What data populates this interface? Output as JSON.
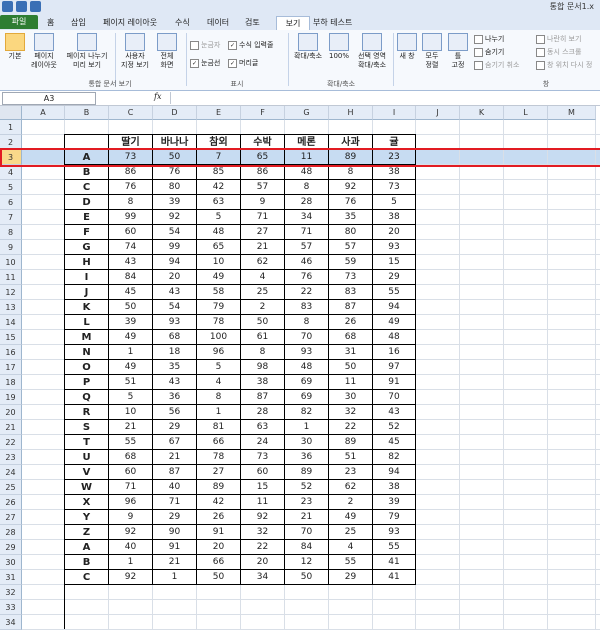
{
  "window": {
    "title": "통합 문서1.x"
  },
  "tabs": [
    "파일",
    "홈",
    "삽입",
    "페이지 레이아웃",
    "수식",
    "데이터",
    "검토",
    "보기",
    "부하 테스트"
  ],
  "active_tab": "보기",
  "ribbon": {
    "normal": "기본",
    "page_layout": "페이지\n레이아웃",
    "page_break": "페이지 나누기\n미리 보기",
    "custom_views": "사용자\n지정 보기",
    "full_screen": "전체\n화면",
    "ruler": "눈금자",
    "formula_bar": "수식 입력줄",
    "gridlines": "눈금선",
    "headings": "머리글",
    "zoom": "확대/축소",
    "zoom100": "100%",
    "zoom_selection": "선택 영역\n확대/축소",
    "new_window": "새 창",
    "arrange_all": "모두\n정렬",
    "freeze_panes": "틀\n고정",
    "split": "나누기",
    "hide": "숨기기",
    "unhide": "숨기기 취소",
    "side_by_side": "나란히 보기",
    "sync_scroll": "동시 스크롤",
    "reset_position": "창 위치 다시 정",
    "group_workbook_views": "통합 문서 보기",
    "group_show": "표시",
    "group_zoom": "확대/축소",
    "group_window": "창"
  },
  "formula_bar": {
    "name_box": "A3",
    "fx": "fx",
    "value": ""
  },
  "columns": [
    "A",
    "B",
    "C",
    "D",
    "E",
    "F",
    "G",
    "H",
    "I",
    "J",
    "K",
    "L",
    "M"
  ],
  "table": {
    "headers": [
      "딸기",
      "바나나",
      "참외",
      "수박",
      "메론",
      "사과",
      "귤"
    ],
    "rows": [
      [
        "A",
        73,
        50,
        7,
        65,
        11,
        89,
        23
      ],
      [
        "B",
        86,
        76,
        85,
        86,
        48,
        8,
        38
      ],
      [
        "C",
        76,
        80,
        42,
        57,
        8,
        92,
        73
      ],
      [
        "D",
        8,
        39,
        63,
        9,
        28,
        76,
        5
      ],
      [
        "E",
        99,
        92,
        5,
        71,
        34,
        35,
        38
      ],
      [
        "F",
        60,
        54,
        48,
        27,
        71,
        80,
        20
      ],
      [
        "G",
        74,
        99,
        65,
        21,
        57,
        57,
        93
      ],
      [
        "H",
        43,
        94,
        10,
        62,
        46,
        59,
        15
      ],
      [
        "I",
        84,
        20,
        49,
        4,
        76,
        73,
        29
      ],
      [
        "J",
        45,
        43,
        58,
        25,
        22,
        83,
        55
      ],
      [
        "K",
        50,
        54,
        79,
        2,
        83,
        87,
        94
      ],
      [
        "L",
        39,
        93,
        78,
        50,
        8,
        26,
        49
      ],
      [
        "M",
        49,
        68,
        100,
        61,
        70,
        68,
        48
      ],
      [
        "N",
        1,
        18,
        96,
        8,
        93,
        31,
        16
      ],
      [
        "O",
        49,
        35,
        5,
        98,
        48,
        50,
        97
      ],
      [
        "P",
        51,
        43,
        4,
        38,
        69,
        11,
        91
      ],
      [
        "Q",
        5,
        36,
        8,
        87,
        69,
        30,
        70
      ],
      [
        "R",
        10,
        56,
        1,
        28,
        82,
        32,
        43
      ],
      [
        "S",
        21,
        29,
        81,
        63,
        1,
        22,
        52
      ],
      [
        "T",
        55,
        67,
        66,
        24,
        30,
        89,
        45
      ],
      [
        "U",
        68,
        21,
        78,
        73,
        36,
        51,
        82
      ],
      [
        "V",
        60,
        87,
        27,
        60,
        89,
        23,
        94
      ],
      [
        "W",
        71,
        40,
        89,
        15,
        52,
        62,
        38
      ],
      [
        "X",
        96,
        71,
        42,
        11,
        23,
        2,
        39
      ],
      [
        "Y",
        9,
        29,
        26,
        92,
        21,
        49,
        79
      ],
      [
        "Z",
        92,
        90,
        91,
        32,
        70,
        25,
        93
      ],
      [
        "A",
        40,
        91,
        20,
        22,
        84,
        4,
        55
      ],
      [
        "B",
        1,
        21,
        66,
        20,
        12,
        55,
        41
      ],
      [
        "C",
        92,
        1,
        50,
        34,
        50,
        29,
        41
      ]
    ]
  },
  "highlight_row": 3,
  "colors": {
    "file_tab": "#2e7d32",
    "selection": "#c7dcf2",
    "highlight_border": "#e21b22",
    "header_bg": "#e4ecf7"
  }
}
